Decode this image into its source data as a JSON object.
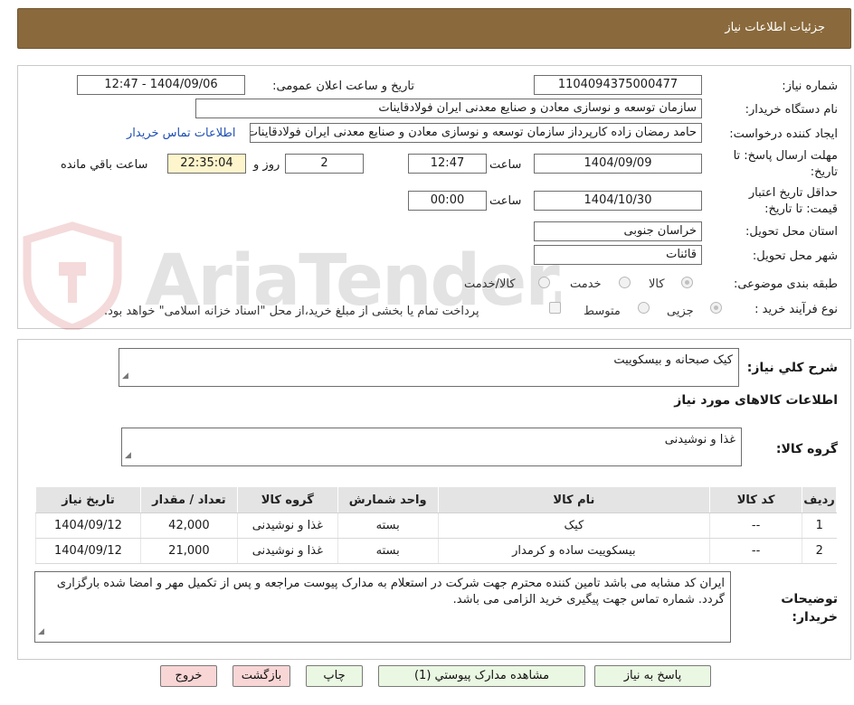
{
  "header": {
    "title": "جزئیات اطلاعات نیاز"
  },
  "form": {
    "need_number_label": "شماره نیاز:",
    "need_number": "1104094375000477",
    "announce_label": "تاریخ و ساعت اعلان عمومی:",
    "announce_value": "1404/09/06 - 12:47",
    "buyer_org_label": "نام دستگاه خریدار:",
    "buyer_org": "سازمان توسعه و نوسازی معادن و صنایع معدنی ایران فولادقاینات",
    "requester_label": "ایجاد کننده درخواست:",
    "requester": "حامد  رمضان زاده  کارپرداز  سازمان توسعه و نوسازی معادن و صنایع معدنی ایران فولادقاینات",
    "contact_link": "اطلاعات تماس خریدار",
    "deadline_label_1": "مهلت ارسال پاسخ: تا",
    "deadline_label_2": "تاریخ:",
    "deadline_date": "1404/09/09",
    "time_label": "ساعت",
    "deadline_time": "12:47",
    "days_value": "2",
    "days_label": "روز و",
    "remaining_time": "22:35:04",
    "remaining_label": "ساعت باقي مانده",
    "validity_label_1": "حداقل تاریخ اعتبار",
    "validity_label_2": "قیمت: تا تاریخ:",
    "validity_date": "1404/10/30",
    "validity_time": "00:00",
    "province_label": "استان محل تحویل:",
    "province": "خراسان جنوبی",
    "city_label": "شهر محل تحویل:",
    "city": "قائنات",
    "category_label": "طبقه بندی موضوعی:",
    "category_options": [
      "کالا",
      "خدمت",
      "کالا/خدمت"
    ],
    "process_label": "نوع فرآیند خرید :",
    "process_options": [
      "جزیی",
      "متوسط"
    ],
    "treasury_note": "پرداخت تمام یا بخشی از مبلغ خرید،از محل \"اسناد خزانه اسلامی\" خواهد بود."
  },
  "summary": {
    "label": "شرح کلي نياز:",
    "value": "کیک صبحانه و بیسکوییت",
    "items_title": "اطلاعات کالاهای مورد نیاز",
    "group_label": "گروه کالا:",
    "group_value": "غذا و نوشیدنی"
  },
  "table": {
    "headers": [
      "ردیف",
      "کد کالا",
      "نام کالا",
      "واحد شمارش",
      "گروه کالا",
      "تعداد / مقدار",
      "تاریخ نیاز"
    ],
    "rows": [
      [
        "1",
        "--",
        "کیک",
        "بسته",
        "غذا و نوشیدنی",
        "42,000",
        "1404/09/12"
      ],
      [
        "2",
        "--",
        "بیسکوییت ساده و کرمدار",
        "بسته",
        "غذا و نوشیدنی",
        "21,000",
        "1404/09/12"
      ]
    ]
  },
  "buyer_notes": {
    "label_1": "توضیحات",
    "label_2": "خریدار:",
    "text": "ایران کد مشابه می باشد تامین کننده محترم جهت شرکت در استعلام به مدارک پیوست مراجعه و پس از تکمیل مهر و امضا شده بارگزاری گردد. شماره تماس جهت پیگیری خرید الزامی می باشد."
  },
  "buttons": {
    "reply": "پاسخ به نیاز",
    "attachments": "مشاهده مدارک پیوستي (1)",
    "print": "چاپ",
    "back": "بازگشت",
    "exit": "خروج"
  },
  "watermark": {
    "text": "AriaTender.neT"
  },
  "colors": {
    "header": "#8a6a3c",
    "button_green": "#eaf7e2",
    "button_red": "#f9d6d6",
    "link": "#1f4fb5"
  }
}
